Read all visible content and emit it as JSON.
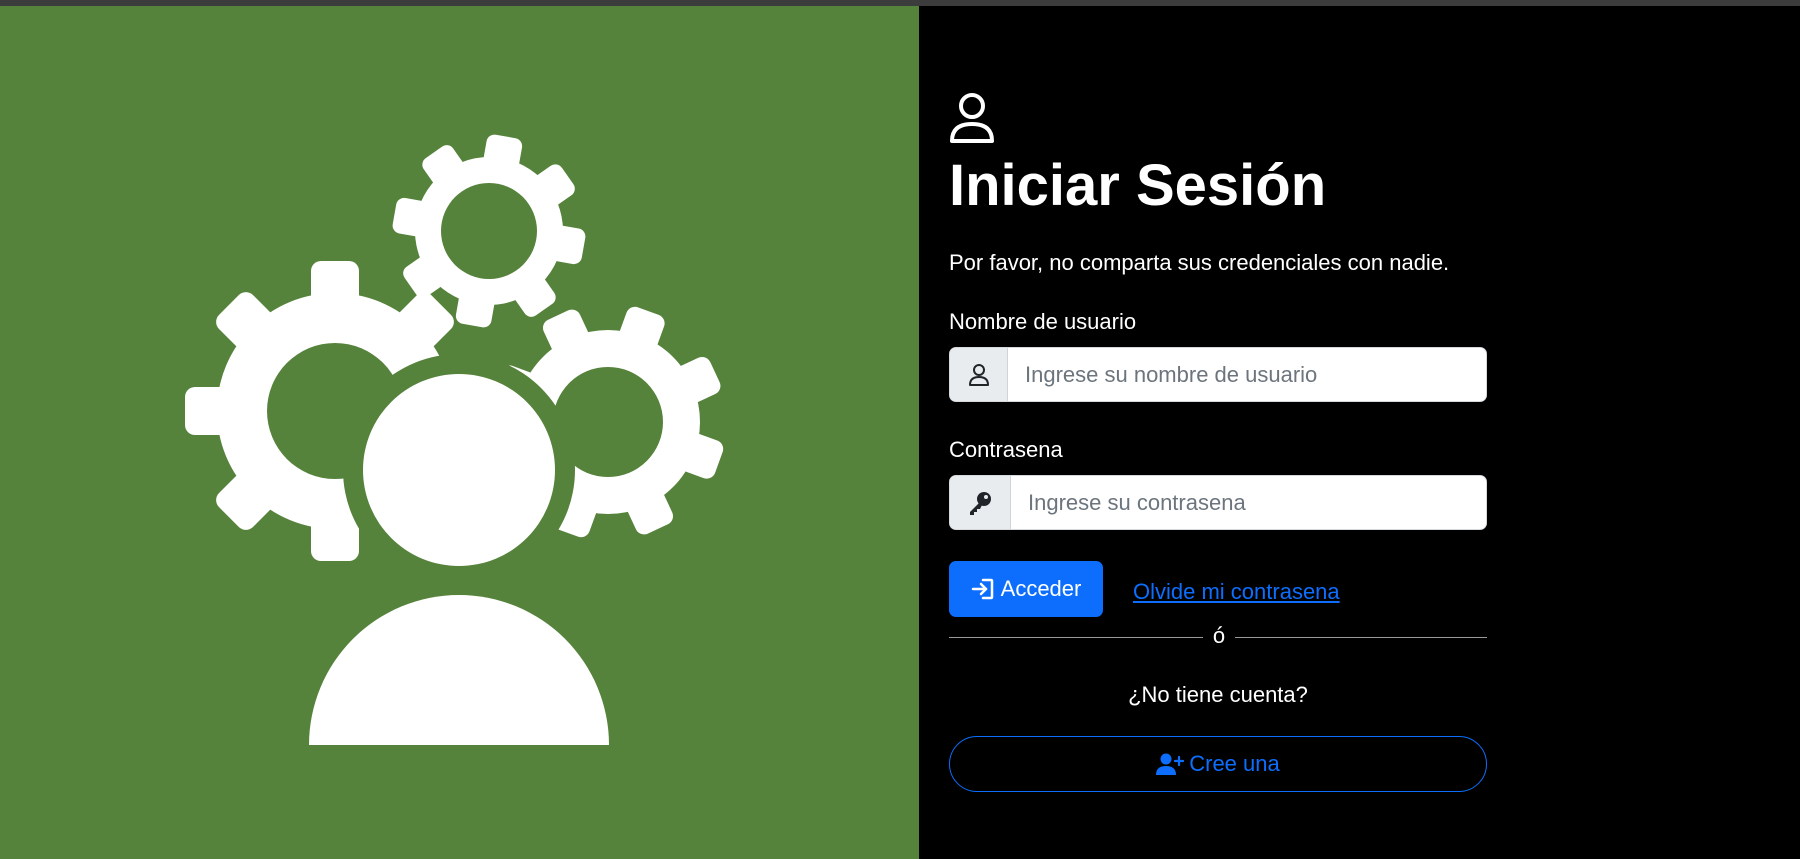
{
  "colors": {
    "left_panel_bg": "#56833b",
    "right_panel_bg": "#000000",
    "primary": "#0d6efd",
    "text": "#ffffff"
  },
  "illustration": {
    "icon": "person-with-gears-icon"
  },
  "login": {
    "header_icon": "person-icon",
    "title": "Iniciar Sesión",
    "subtitle": "Por favor, no comparta sus credenciales con nadie.",
    "username": {
      "label": "Nombre de usuario",
      "icon": "person-icon",
      "placeholder": "Ingrese su nombre de usuario",
      "value": ""
    },
    "password": {
      "label": "Contrasena",
      "icon": "key-icon",
      "placeholder": "Ingrese su contrasena",
      "value": ""
    },
    "submit": {
      "icon": "box-arrow-in-right-icon",
      "label": "Acceder"
    },
    "forgot_link": "Olvide mi contrasena",
    "divider_text": "ó",
    "no_account_text": "¿No tiene cuenta?",
    "register": {
      "icon": "person-plus-icon",
      "label": "Cree una"
    }
  }
}
